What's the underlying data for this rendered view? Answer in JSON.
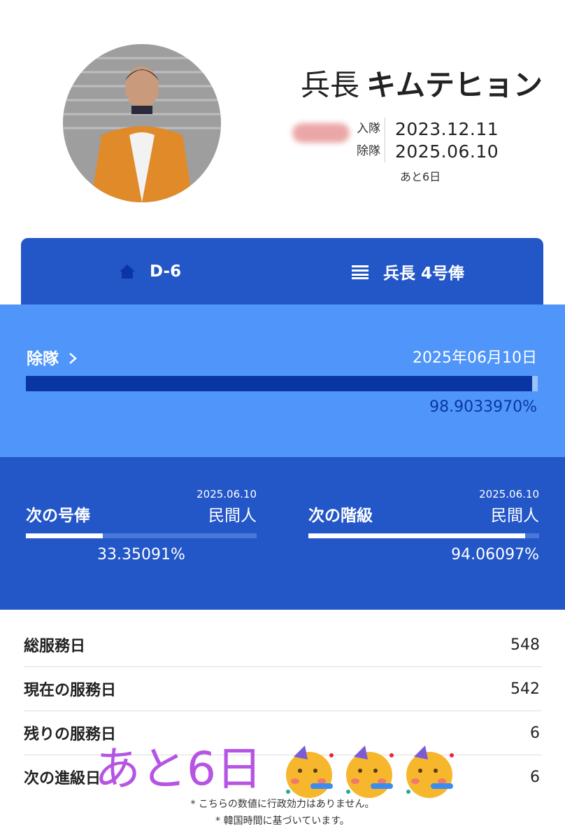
{
  "header": {
    "rank": "兵長",
    "name": "キムテヒョン",
    "enlist_label": "入隊",
    "enlist_date": "2023.12.11",
    "discharge_label": "除隊",
    "discharge_date": "2025.06.10",
    "remaining": "あと6日"
  },
  "tabs": [
    {
      "label": "D-6",
      "icon": "home-icon"
    },
    {
      "label": "兵長 4号俸",
      "icon": "list-icon"
    }
  ],
  "discharge": {
    "label": "除隊",
    "date": "2025年06月10日",
    "percent_text": "98.9033970%",
    "progress": 0.98903397
  },
  "next": [
    {
      "title": "次の号俸",
      "date": "2025.06.10",
      "value": "民間人",
      "percent_text": "33.35091%",
      "progress": 0.3335091
    },
    {
      "title": "次の階級",
      "date": "2025.06.10",
      "value": "民間人",
      "percent_text": "94.06097%",
      "progress": 0.9406097
    }
  ],
  "stats": [
    {
      "label": "総服務日",
      "value": "548"
    },
    {
      "label": "現在の服務日",
      "value": "542"
    },
    {
      "label": "残りの服務日",
      "value": "6"
    },
    {
      "label": "次の進級日",
      "value": "6"
    }
  ],
  "notes": [
    "* こちらの数値に行政効力はありません。",
    "* 韓国時間に基づいています。"
  ],
  "overlay": {
    "text": "あと6日",
    "emoji": [
      "partying-face-icon",
      "partying-face-icon",
      "partying-face-icon"
    ]
  },
  "colors": {
    "tab_bg": "#2356c7",
    "discharge_bg": "#4f95fa",
    "progress_dark": "#0a36a3",
    "overlay_text": "#b654e3"
  }
}
